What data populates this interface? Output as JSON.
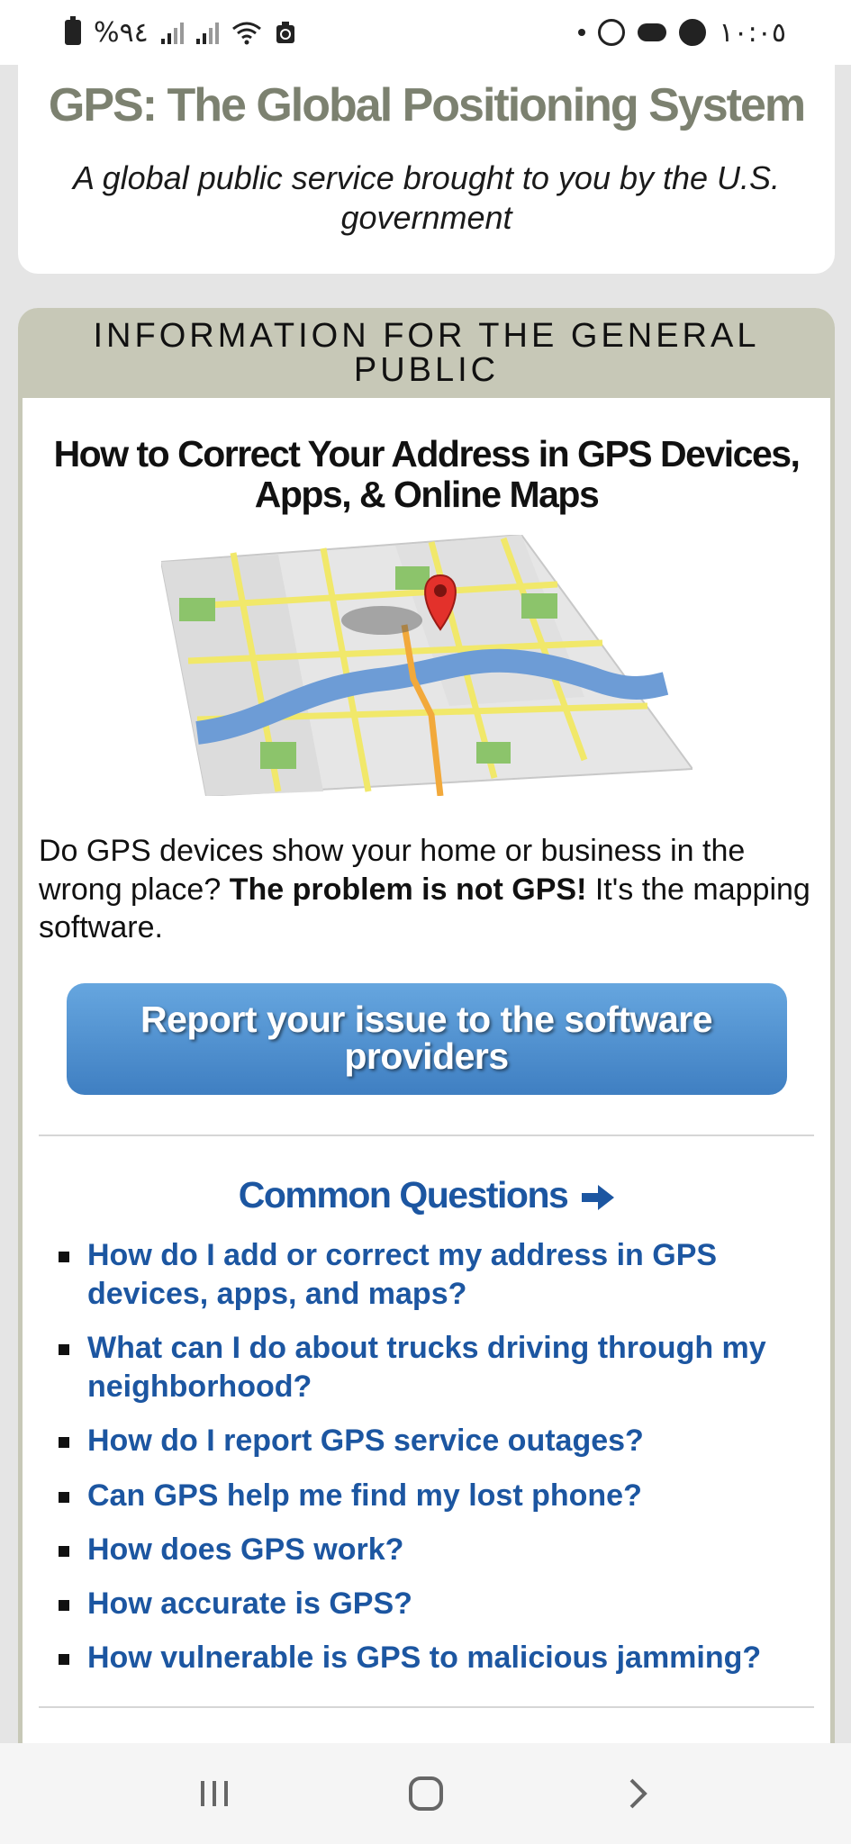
{
  "status_bar": {
    "battery_text": "%٩٤",
    "time": "١٠:٠٥"
  },
  "header": {
    "title": "GPS: The Global Positioning System",
    "subtitle": "A global public service brought to you by the U.S. government"
  },
  "panel": {
    "heading": "INFORMATION FOR THE GENERAL PUBLIC",
    "article_title": "How to Correct Your Address in GPS Devices, Apps, & Online Maps",
    "intro_start": "Do GPS devices show your home or business in the wrong place?",
    "intro_bold": "The problem is not GPS!",
    "intro_end": "It's the mapping software.",
    "report_button": "Report your issue to the software providers",
    "common_questions_title": "Common Questions",
    "questions": [
      "How do I add or correct my address in GPS devices, apps, and maps?",
      "What can I do about trucks driving through my neighborhood?",
      "How do I report GPS service outages?",
      "Can GPS help me find my lost phone?",
      "How does GPS work?",
      "How accurate is GPS?",
      "How vulnerable is GPS to malicious jamming?"
    ]
  },
  "icons": {
    "status_left": [
      "battery-icon",
      "signal-icon",
      "signal-icon",
      "wifi-icon",
      "recycle-icon"
    ],
    "status_right": [
      "dot-icon",
      "whatsapp-icon",
      "cloud-icon",
      "facebook-icon"
    ],
    "nav": [
      "recent-apps-icon",
      "home-icon",
      "back-icon"
    ]
  },
  "colors": {
    "title_gray": "#7c8170",
    "panel_head": "#c7c8b7",
    "link_blue": "#1c56a1",
    "button_blue": "#4f8fd1"
  }
}
